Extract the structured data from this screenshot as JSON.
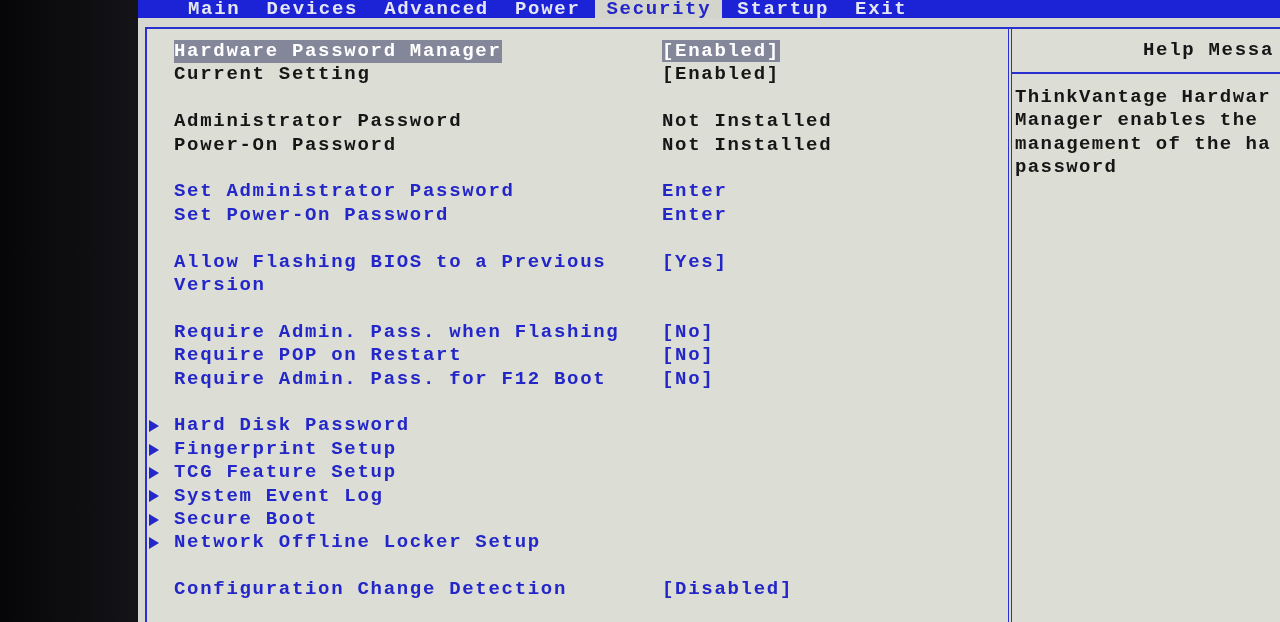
{
  "menu_bar": {
    "tabs": [
      {
        "label": "Main",
        "selected": false
      },
      {
        "label": "Devices",
        "selected": false
      },
      {
        "label": "Advanced",
        "selected": false
      },
      {
        "label": "Power",
        "selected": false
      },
      {
        "label": "Security",
        "selected": true
      },
      {
        "label": "Startup",
        "selected": false
      },
      {
        "label": "Exit",
        "selected": false
      }
    ]
  },
  "settings": {
    "groups": [
      {
        "items": [
          {
            "kind": "option",
            "label": "Hardware Password Manager",
            "value": "[Enabled]",
            "selected": true
          },
          {
            "kind": "info",
            "label": "Current Setting",
            "value": "[Enabled]",
            "selected": false
          }
        ]
      },
      {
        "items": [
          {
            "kind": "info",
            "label": "Administrator Password",
            "value": "Not Installed",
            "selected": false
          },
          {
            "kind": "info",
            "label": "Power-On Password",
            "value": "Not Installed",
            "selected": false
          }
        ]
      },
      {
        "items": [
          {
            "kind": "option",
            "label": "Set Administrator Password",
            "value": "Enter",
            "selected": false
          },
          {
            "kind": "option",
            "label": "Set Power-On Password",
            "value": "Enter",
            "selected": false
          }
        ]
      },
      {
        "items": [
          {
            "kind": "option",
            "label": "Allow Flashing BIOS to a Previous Version",
            "value": "[Yes]",
            "selected": false
          }
        ]
      },
      {
        "items": [
          {
            "kind": "option",
            "label": "Require Admin. Pass. when Flashing",
            "value": "[No]",
            "selected": false
          },
          {
            "kind": "option",
            "label": "Require POP on Restart",
            "value": "[No]",
            "selected": false
          },
          {
            "kind": "option",
            "label": "Require Admin. Pass. for F12 Boot",
            "value": "[No]",
            "selected": false
          }
        ]
      },
      {
        "items": [
          {
            "kind": "submenu",
            "label": "Hard Disk Password",
            "selected": false
          },
          {
            "kind": "submenu",
            "label": "Fingerprint Setup",
            "selected": false
          },
          {
            "kind": "submenu",
            "label": "TCG Feature Setup",
            "selected": false
          },
          {
            "kind": "submenu",
            "label": "System Event Log",
            "selected": false
          },
          {
            "kind": "submenu",
            "label": "Secure Boot",
            "selected": false
          },
          {
            "kind": "submenu",
            "label": "Network Offline Locker Setup",
            "selected": false
          }
        ]
      },
      {
        "items": [
          {
            "kind": "option",
            "label": "Configuration Change Detection",
            "value": "[Disabled]",
            "selected": false
          }
        ]
      }
    ]
  },
  "help": {
    "title": "Help Messa",
    "lines": [
      "ThinkVantage Hardwar",
      "Manager enables the",
      "management of the ha",
      "password"
    ]
  }
}
